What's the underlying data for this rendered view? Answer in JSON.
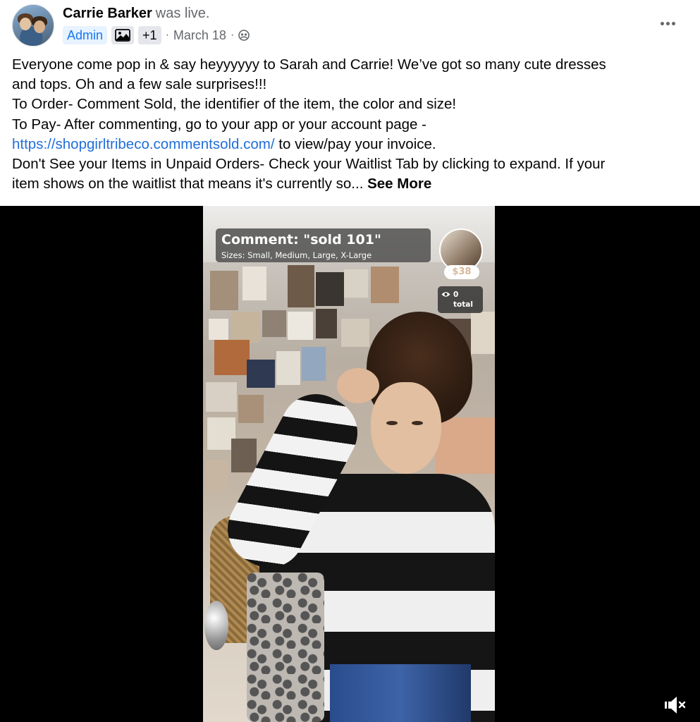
{
  "post": {
    "author": "Carrie Barker",
    "status": "was live.",
    "badges": {
      "admin": "Admin",
      "extra": "+1"
    },
    "date": "March 18",
    "separator": "·",
    "privacy_icon": "group-audience-icon"
  },
  "body": {
    "line1": "Everyone come pop in & say heyyyyyy to Sarah and Carrie! We’ve got so many cute dresses",
    "line2": "and tops. Oh and a few sale surprises!!!",
    "line3": "To Order- Comment Sold, the identifier of the item, the color and size!",
    "line4": "To Pay- After commenting, go to your app or your account page -",
    "link": "https://shopgirltribeco.commentsold.com/",
    "line5_after_link": " to view/pay your invoice.",
    "line6": "Don't See your Items in Unpaid Orders- Check your Waitlist Tab by clicking to expand. If your",
    "line7": "item shows on the waitlist that means it's currently so... ",
    "see_more": "See More"
  },
  "video": {
    "overlay_title": "Comment: \"sold 101\"",
    "overlay_sizes": "Sizes: Small, Medium, Large, X-Large",
    "price": "$38",
    "viewer_count": "0",
    "viewer_label": "total"
  },
  "colors": {
    "link": "#216fdb",
    "admin_badge_bg": "#e7f3ff",
    "admin_badge_text": "#1877f2",
    "secondary_text": "#65676b"
  }
}
